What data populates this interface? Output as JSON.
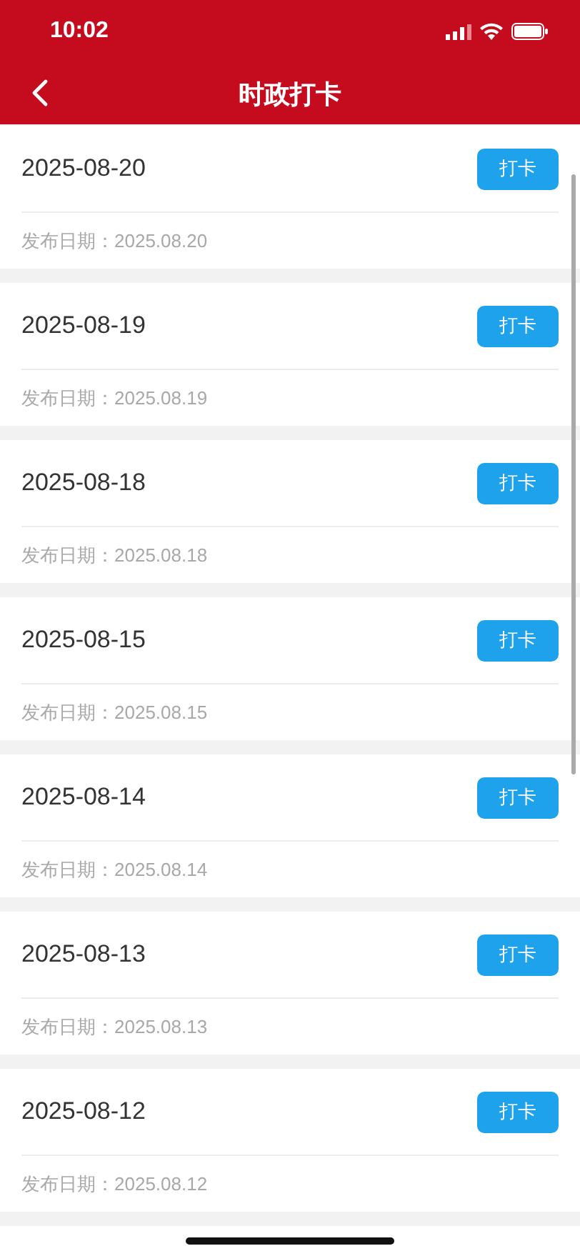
{
  "status_bar": {
    "time": "10:02"
  },
  "nav": {
    "title": "时政打卡"
  },
  "items": [
    {
      "title": "2025-08-20",
      "published": "发布日期：2025.08.20",
      "button": "打卡"
    },
    {
      "title": "2025-08-19",
      "published": "发布日期：2025.08.19",
      "button": "打卡"
    },
    {
      "title": "2025-08-18",
      "published": "发布日期：2025.08.18",
      "button": "打卡"
    },
    {
      "title": "2025-08-15",
      "published": "发布日期：2025.08.15",
      "button": "打卡"
    },
    {
      "title": "2025-08-14",
      "published": "发布日期：2025.08.14",
      "button": "打卡"
    },
    {
      "title": "2025-08-13",
      "published": "发布日期：2025.08.13",
      "button": "打卡"
    },
    {
      "title": "2025-08-12",
      "published": "发布日期：2025.08.12",
      "button": "打卡"
    }
  ]
}
